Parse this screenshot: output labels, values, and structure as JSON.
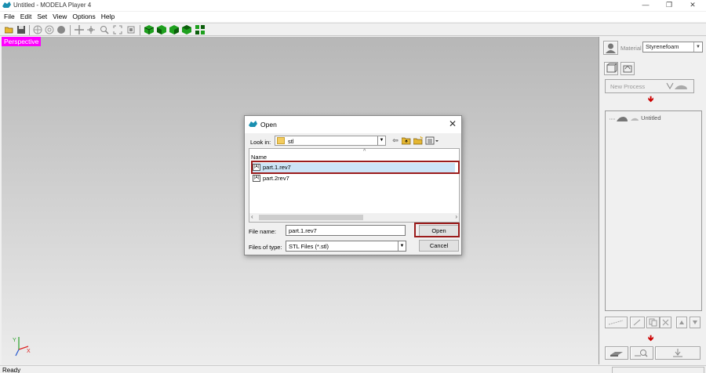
{
  "window": {
    "title": "Untitled - MODELA Player 4",
    "minimize": "—",
    "maximize": "❐",
    "close": "✕"
  },
  "menu": [
    "File",
    "Edit",
    "Set",
    "View",
    "Options",
    "Help"
  ],
  "viewport": {
    "label": "Perspective",
    "label_color": "#ff00ff",
    "axis_y": "Y",
    "axis_x": "X"
  },
  "right_panel": {
    "material_label": "Material",
    "material_value": "Styrenefoam",
    "new_process_label": "New Process",
    "process_tree_root": "Untitled"
  },
  "dialog": {
    "title": "Open",
    "look_in_label": "Look in:",
    "look_in_value": "stl",
    "column_name": "Name",
    "files": [
      {
        "name": "part.1.rev7",
        "selected": true
      },
      {
        "name": "part.2rev7",
        "selected": false
      }
    ],
    "file_name_label": "File name:",
    "file_name_value": "part.1.rev7",
    "file_type_label": "Files of type:",
    "file_type_value": "STL Files (*.stl)",
    "open_button": "Open",
    "cancel_button": "Cancel",
    "highlight_color": "#9b1c1c"
  },
  "status": {
    "text": "Ready"
  }
}
